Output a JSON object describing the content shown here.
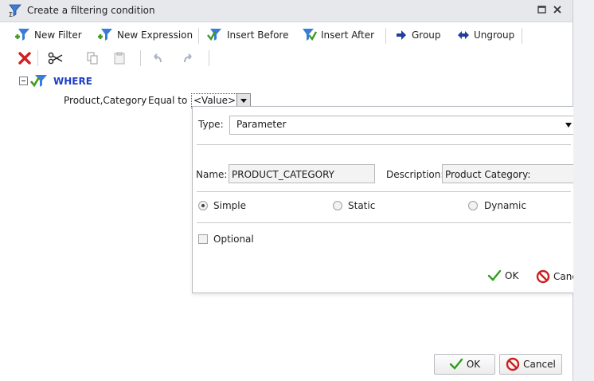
{
  "dialog": {
    "title": "Create a filtering condition",
    "icons": {
      "title": "filter-sigma-icon",
      "maximize": "maximize-icon",
      "close": "close-icon"
    }
  },
  "toolbar": {
    "new_filter": "New Filter",
    "new_expression": "New Expression",
    "insert_before": "Insert Before",
    "insert_after": "Insert After",
    "group": "Group",
    "ungroup": "Ungroup"
  },
  "tree": {
    "root_label": "WHERE",
    "condition": {
      "field": "Product,Category",
      "operator": "Equal to",
      "value": "<Value>"
    }
  },
  "value_popup": {
    "type_label": "Type:",
    "type_value": "Parameter",
    "name_label": "Name:",
    "name_value": "PRODUCT_CATEGORY",
    "description_label": "Description:",
    "description_value": "Product Category:",
    "radios": [
      {
        "label": "Simple",
        "checked": true
      },
      {
        "label": "Static",
        "checked": false
      },
      {
        "label": "Dynamic",
        "checked": false
      }
    ],
    "optional_label": "Optional",
    "optional_checked": false,
    "ok_label": "OK",
    "cancel_label": "Cancel"
  },
  "footer": {
    "ok_label": "OK",
    "cancel_label": "Cancel"
  },
  "colors": {
    "accent_blue": "#1d3fc8",
    "filter_green": "#3f9a1f",
    "delete_red": "#d21f1f",
    "ok_green": "#2e9e1b",
    "cancel_red": "#cc1f1f",
    "titlebar_bg": "#e6e8eb"
  }
}
